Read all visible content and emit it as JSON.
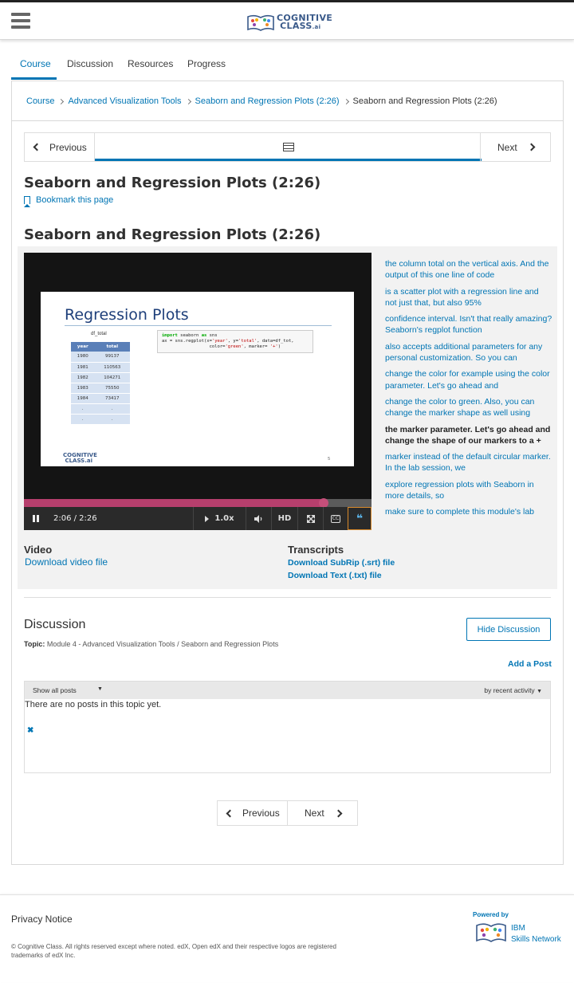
{
  "header": {
    "logo_line1": "COGNITIVE",
    "logo_line2": "CLASS",
    "logo_suffix": ".ai"
  },
  "course_tabs": [
    {
      "label": "Course",
      "active": true
    },
    {
      "label": "Discussion",
      "active": false
    },
    {
      "label": "Resources",
      "active": false
    },
    {
      "label": "Progress",
      "active": false
    }
  ],
  "breadcrumb": [
    "Course",
    "Advanced Visualization Tools",
    "Seaborn and Regression Plots (2:26)",
    "Seaborn and Regression Plots (2:26)"
  ],
  "sequence_nav": {
    "previous": "Previous",
    "next": "Next",
    "unit_icon": "film-icon"
  },
  "unit": {
    "title": "Seaborn and Regression Plots (2:26)",
    "bookmark": "Bookmark this page",
    "video_title": "Seaborn and Regression Plots (2:26)"
  },
  "slide": {
    "title": "Regression Plots",
    "df_label": "df_total",
    "df_headers": [
      "year",
      "total"
    ],
    "df_rows": [
      [
        "1980",
        "99137"
      ],
      [
        "1981",
        "110563"
      ],
      [
        "1982",
        "104271"
      ],
      [
        "1983",
        "75550"
      ],
      [
        "1984",
        "73417"
      ],
      [
        ".",
        "."
      ],
      [
        ".",
        "."
      ]
    ],
    "logo": "COGNITIVE",
    "logo2": "CLASS.ai",
    "page_num": "5"
  },
  "player": {
    "time": "2:06 / 2:26",
    "progress": 0.863,
    "speed": "1.0x",
    "hd": "HD",
    "pause_icon": "pause-icon",
    "volume_icon": "volume-icon",
    "fullscreen_icon": "fullscreen-icon",
    "cc_icon": "closed-captions-icon",
    "transcript_icon": "quote-icon",
    "accent": "#b63f6d"
  },
  "transcript": [
    "the column total on the vertical axis. And the output of this one line of code",
    "is a scatter plot with a regression line and not just that, but also 95%",
    "confidence interval. Isn't that really amazing? Seaborn's regplot function",
    "also accepts additional parameters for any personal customization. So you can",
    "change the color for example using the color parameter. Let's go ahead and",
    "change the color to green. Also, you can change the marker shape as well using",
    "the marker parameter. Let's go ahead and change the shape of our markers to a +",
    "marker instead of the default circular marker. In the lab session, we",
    "explore regression plots with Seaborn in more details, so",
    "make sure to complete this module's lab"
  ],
  "transcript_current_index": 6,
  "downloads": {
    "video_heading": "Video",
    "video_link": "Download video file",
    "transcripts_heading": "Transcripts",
    "srt_link": "Download SubRip (.srt) file",
    "txt_link": "Download Text (.txt) file"
  },
  "discussion": {
    "title": "Discussion",
    "hide_button": "Hide Discussion",
    "topic_label": "Topic:",
    "topic_value": "Module 4 - Advanced Visualization Tools / Seaborn and Regression Plots",
    "add_post": "Add a Post",
    "filter": "Show all posts",
    "sort": "by recent activity",
    "empty": "There are no posts in this topic yet.",
    "close_glyph": "✖"
  },
  "bottom_nav": {
    "previous": "Previous",
    "next": "Next"
  },
  "footer": {
    "privacy": "Privacy Notice",
    "copyright": "© Cognitive Class. All rights reserved except where noted. edX, Open edX and their respective logos are registered trademarks of edX Inc.",
    "powered_by": "Powered by",
    "partner_line1": "IBM",
    "partner_line2": "Skills Network"
  },
  "colors": {
    "link": "#0075b4",
    "text": "#313131"
  }
}
